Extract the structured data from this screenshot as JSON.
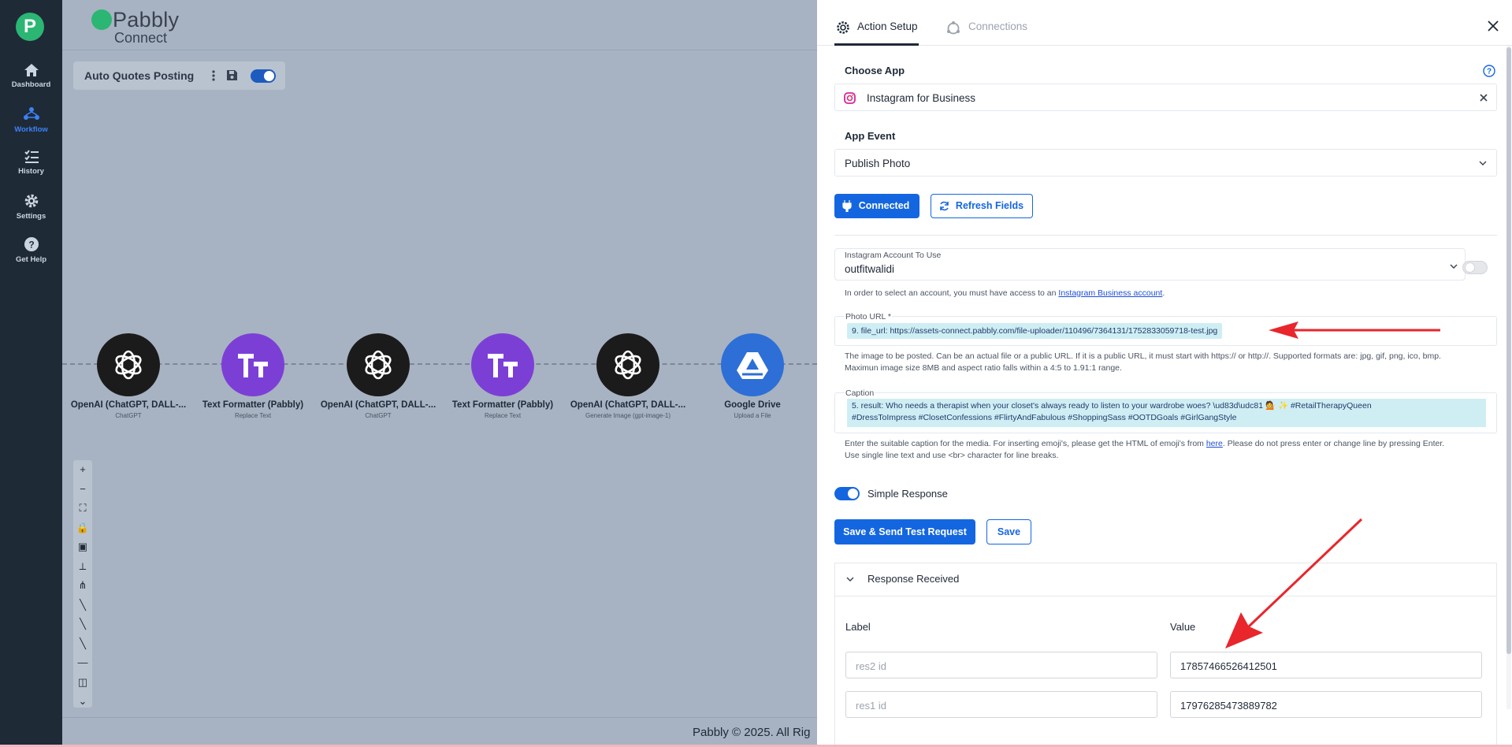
{
  "sidebar": {
    "logo": "P",
    "items": [
      {
        "label": "Dashboard",
        "icon": "home-icon",
        "active": false
      },
      {
        "label": "Workflow",
        "icon": "workflow-icon",
        "active": true
      },
      {
        "label": "History",
        "icon": "history-icon",
        "active": false
      },
      {
        "label": "Settings",
        "icon": "gear-icon",
        "active": false
      },
      {
        "label": "Get Help",
        "icon": "help-icon",
        "active": false
      }
    ]
  },
  "brand": {
    "name": "Pabbly",
    "sub": "Connect"
  },
  "workflow": {
    "name": "Auto Quotes Posting",
    "enabled": true
  },
  "nodes": [
    {
      "title": "OpenAI (ChatGPT, DALL-...",
      "sub": "ChatGPT",
      "icon": "openai-icon",
      "color": "#1b1b1b"
    },
    {
      "title": "Text Formatter (Pabbly)",
      "sub": "Replace Text",
      "icon": "text-formatter-icon",
      "color": "#7c3fd6"
    },
    {
      "title": "OpenAI (ChatGPT, DALL-...",
      "sub": "ChatGPT",
      "icon": "openai-icon",
      "color": "#1b1b1b"
    },
    {
      "title": "Text Formatter (Pabbly)",
      "sub": "Replace Text",
      "icon": "text-formatter-icon",
      "color": "#7c3fd6"
    },
    {
      "title": "OpenAI (ChatGPT, DALL-...",
      "sub": "Generate Image (gpt-image-1)",
      "icon": "openai-icon",
      "color": "#1b1b1b"
    },
    {
      "title": "Google Drive",
      "sub": "Upload a File",
      "icon": "google-drive-icon",
      "color": "#2d6fd6"
    }
  ],
  "controls": [
    "+",
    "−",
    "⛶",
    "🔒",
    "▣",
    "⟂",
    "⋔",
    "╲",
    "╲",
    "╲",
    "—",
    "◫",
    "⌄"
  ],
  "footer": {
    "copyright": "Pabbly © 2025. All Rig"
  },
  "panel": {
    "tabs": [
      {
        "label": "Action Setup",
        "icon": "gear-icon",
        "active": true
      },
      {
        "label": "Connections",
        "icon": "connections-icon",
        "active": false
      }
    ],
    "choose_app": {
      "label": "Choose App",
      "value": "Instagram for Business"
    },
    "app_event": {
      "label": "App Event",
      "value": "Publish Photo"
    },
    "connected_label": "Connected",
    "refresh_label": "Refresh Fields",
    "account": {
      "label": "Instagram Account To Use",
      "value": "outfitwalidi",
      "help_prefix": "In order to select an account, you must have access to an ",
      "help_link": "Instagram Business account",
      "help_suffix": "."
    },
    "photo_url": {
      "label": "Photo URL *",
      "chip": "9. file_url: https://assets-connect.pabbly.com/file-uploader/110496/7364131/1752833059718-test.jpg",
      "help_line1": "The image to be posted. Can be an actual file or a public URL. If it is a public URL, it must start with https:// or http://. Supported formats are: jpg, gif, png, ico, bmp.",
      "help_line2": "Maximun image size 8MB and aspect ratio falls within a 4:5 to 1.91:1 range."
    },
    "caption": {
      "label": "Caption",
      "chip_line1": "5. result: Who needs a therapist when your closet's always ready to listen to your wardrobe woes? \\ud83d\\udc81 💁 ✨ #RetailTherapyQueen",
      "chip_line2": "#DressToImpress #ClosetConfessions #FlirtyAndFabulous #ShoppingSass #OOTDGoals #GirlGangStyle",
      "help_line1_prefix": "Enter the suitable caption for the media. For inserting emoji's, please get the HTML of emoji's from ",
      "help_link": "here",
      "help_line1_suffix": ". Please do not press enter or change line by pressing Enter.",
      "help_line2": "Use single line text and use <br> character for line breaks."
    },
    "simple_response": {
      "label": "Simple Response",
      "enabled": true
    },
    "save_send_label": "Save & Send Test Request",
    "save_label": "Save",
    "response": {
      "title": "Response Received",
      "label_header": "Label",
      "value_header": "Value",
      "rows": [
        {
          "label": "res2 id",
          "value": "17857466526412501"
        },
        {
          "label": "res1 id",
          "value": "17976285473889782"
        }
      ]
    }
  },
  "colors": {
    "primary": "#1466e0",
    "sidebar": "#1f2a37",
    "annotation": "#e8262c"
  }
}
